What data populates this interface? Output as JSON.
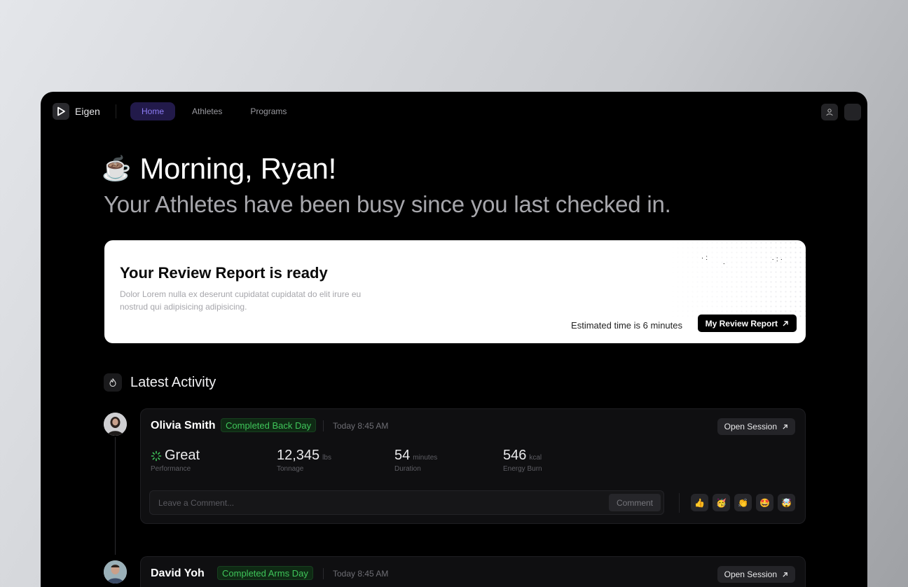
{
  "app": {
    "name": "Eigen",
    "nav": [
      {
        "label": "Home",
        "active": true
      },
      {
        "label": "Athletes",
        "active": false
      },
      {
        "label": "Programs",
        "active": false
      }
    ]
  },
  "greeting": {
    "emoji": "☕",
    "title": "Morning, Ryan!",
    "subtitle": "Your Athletes have been busy since you last checked in."
  },
  "review": {
    "title": "Your Review Report is ready",
    "description": "Dolor Lorem nulla ex deserunt cupidatat cupidatat do elit irure eu nostrud qui adipisicing adipisicing.",
    "estimate": "Estimated time is 6 minutes",
    "button_label": "My Review Report",
    "button_icon": "arrow-up-right-icon"
  },
  "activity": {
    "title": "Latest Activity",
    "icon": "flame-icon",
    "items": [
      {
        "name": "Olivia Smith",
        "badge": "Completed Back Day",
        "time": "Today 8:45 AM",
        "open_label": "Open Session",
        "stats": [
          {
            "value": "Great",
            "unit": "",
            "label": "Performance"
          },
          {
            "value": "12,345",
            "unit": "lbs",
            "label": "Tonnage"
          },
          {
            "value": "54",
            "unit": "minutes",
            "label": "Duration"
          },
          {
            "value": "546",
            "unit": "kcal",
            "label": "Energy Burn"
          }
        ],
        "comment_placeholder": "Leave a Comment...",
        "comment_button": "Comment",
        "reactions": [
          "👍",
          "🥳",
          "👏",
          "🤩",
          "🤯"
        ]
      },
      {
        "name": "David Yoh",
        "badge": "Completed Arms Day",
        "time": "Today 8:45 AM",
        "open_label": "Open Session"
      }
    ]
  },
  "colors": {
    "accent": "#8d7cf5",
    "success": "#3fc55a",
    "background": "#000000"
  }
}
